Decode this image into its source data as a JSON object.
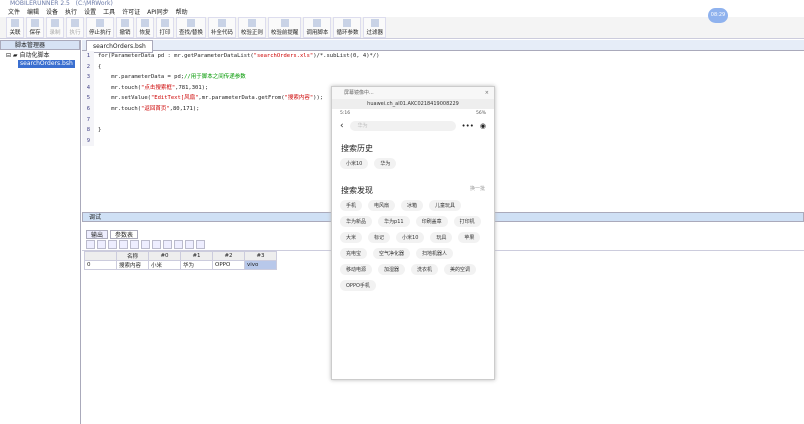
{
  "app": {
    "title": "MOBILERUNNER 2.5",
    "subtitle": "(C:\\MRWork)",
    "clock": "08:29"
  },
  "menu": [
    "文件",
    "编辑",
    "设备",
    "执行",
    "设置",
    "工具",
    "许可证",
    "API同步",
    "帮助"
  ],
  "toolbar": [
    {
      "label": "关联",
      "enabled": true
    },
    {
      "label": "保存",
      "enabled": true
    },
    {
      "label": "录制",
      "enabled": false
    },
    {
      "label": "执行",
      "enabled": false
    },
    {
      "label": "停止执行",
      "enabled": true
    },
    {
      "label": "撤销",
      "enabled": true
    },
    {
      "label": "恢复",
      "enabled": true
    },
    {
      "label": "打印",
      "enabled": true
    },
    {
      "label": "查找/替换",
      "enabled": true
    },
    {
      "label": "补全代码",
      "enabled": true
    },
    {
      "label": "校验正则",
      "enabled": true
    },
    {
      "label": "校验前提醒",
      "enabled": true
    },
    {
      "label": "调用脚本",
      "enabled": true
    },
    {
      "label": "循环参数",
      "enabled": true
    },
    {
      "label": "过滤器",
      "enabled": true
    }
  ],
  "left": {
    "tab": "脚本管理器",
    "tree_root": "自动化脚本",
    "tree_file": "searchOrders.bsh"
  },
  "editor": {
    "tab": "searchOrders.bsh",
    "lines": [
      {
        "n": "1",
        "parts": [
          {
            "t": "for(ParameterData pd : mr.getParameterDataList(",
            "c": ""
          },
          {
            "t": "\"searchOrders.xls\"",
            "c": "str"
          },
          {
            "t": ")/*.subList(0, 4)*/)",
            "c": ""
          }
        ]
      },
      {
        "n": "2",
        "parts": [
          {
            "t": "{",
            "c": ""
          }
        ]
      },
      {
        "n": "3",
        "parts": [
          {
            "t": "    mr.parameterData = pd;",
            "c": ""
          },
          {
            "t": "//用于脚本之间传递参数",
            "c": "cm"
          }
        ]
      },
      {
        "n": "4",
        "parts": [
          {
            "t": "    mr.touch(",
            "c": ""
          },
          {
            "t": "\"点击搜索框\"",
            "c": "str"
          },
          {
            "t": ",781,301);",
            "c": ""
          }
        ]
      },
      {
        "n": "5",
        "parts": [
          {
            "t": "    mr.setValue(",
            "c": ""
          },
          {
            "t": "\"EditText[风扇\"",
            "c": "str"
          },
          {
            "t": ",mr.parameterData.getFrom(",
            "c": ""
          },
          {
            "t": "\"搜索内容\"",
            "c": "str"
          },
          {
            "t": "));",
            "c": ""
          }
        ]
      },
      {
        "n": "6",
        "parts": [
          {
            "t": "    mr.touch(",
            "c": ""
          },
          {
            "t": "\"返回首页\"",
            "c": "str"
          },
          {
            "t": ",80,171);",
            "c": ""
          }
        ]
      },
      {
        "n": "7",
        "parts": [
          {
            "t": "",
            "c": ""
          }
        ]
      },
      {
        "n": "8",
        "parts": [
          {
            "t": "}",
            "c": ""
          }
        ]
      },
      {
        "n": "9",
        "parts": [
          {
            "t": "",
            "c": ""
          }
        ]
      }
    ]
  },
  "bottom": {
    "tab": "调试",
    "tabs": [
      "输出",
      "参数表"
    ],
    "table": {
      "headers": [
        "",
        "名称",
        "#0",
        "#1",
        "#2",
        "#3"
      ],
      "rows": [
        [
          "0",
          "搜索内容",
          "小米",
          "华为",
          "OPPO",
          "vivo"
        ]
      ]
    }
  },
  "phone": {
    "window_title": "屏幕镜像中...",
    "close": "×",
    "device": "huawei.ch_al01.AKC0218419008229",
    "status_left": "5:16",
    "status_right": "56%",
    "search_placeholder": "华为",
    "more": "•••",
    "history_title": "搜索历史",
    "history": [
      "小米10",
      "华为"
    ],
    "discover_title": "搜索发现",
    "refresh": "换一批",
    "discover": [
      "手机",
      "电风扇",
      "冰箱",
      "儿童玩具",
      "华为新品",
      "华为p11",
      "印刷盖章",
      "打印机",
      "大米",
      "标记",
      "小米10",
      "玩具",
      "苹果",
      "充电宝",
      "空气净化器",
      "扫地机器人",
      "移动电源",
      "加湿器",
      "洗衣机",
      "美的空调",
      "OPPO手机"
    ]
  }
}
